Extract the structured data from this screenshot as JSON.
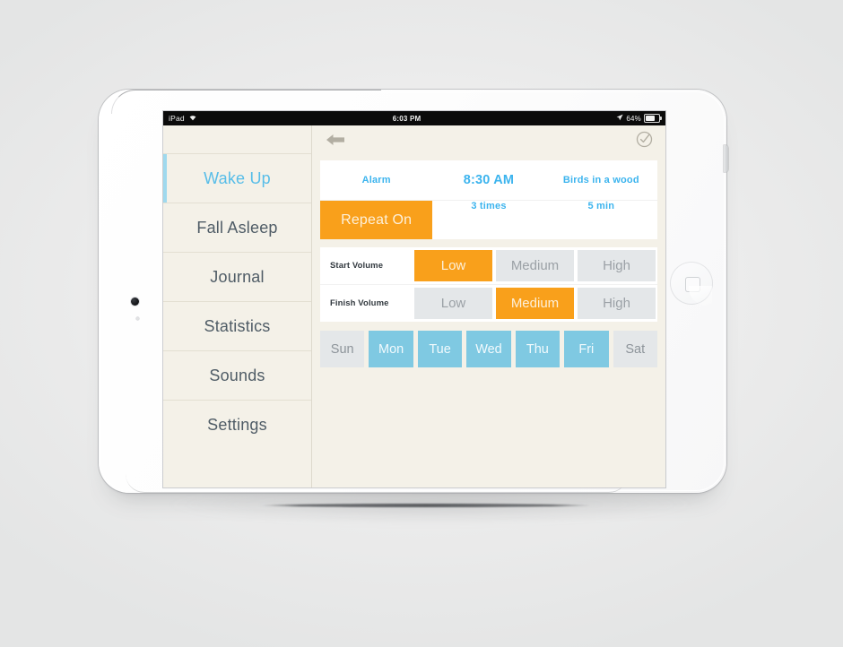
{
  "status_bar": {
    "carrier": "iPad",
    "wifi_icon": "wifi-icon",
    "time": "6:03 PM",
    "location_icon": "location-arrow-icon",
    "battery_percent": "64%",
    "battery_icon": "battery-icon"
  },
  "sidebar": {
    "items": [
      {
        "label": "Wake Up",
        "active": true
      },
      {
        "label": "Fall Asleep",
        "active": false
      },
      {
        "label": "Journal",
        "active": false
      },
      {
        "label": "Statistics",
        "active": false
      },
      {
        "label": "Sounds",
        "active": false
      },
      {
        "label": "Settings",
        "active": false
      }
    ]
  },
  "toolbar": {
    "back_icon": "back-arrow-icon",
    "confirm_icon": "check-circle-icon"
  },
  "alarm": {
    "label": "Alarm",
    "time": "8:30 AM",
    "sound": "Birds in a wood",
    "repeat_label": "Repeat On",
    "repeat_times": "3 times",
    "repeat_interval": "5 min"
  },
  "volume": {
    "start_label": "Start Volume",
    "finish_label": "Finish Volume",
    "options": [
      "Low",
      "Medium",
      "High"
    ],
    "start_selected": "Low",
    "finish_selected": "Medium"
  },
  "days": [
    {
      "label": "Sun",
      "on": false
    },
    {
      "label": "Mon",
      "on": true
    },
    {
      "label": "Tue",
      "on": true
    },
    {
      "label": "Wed",
      "on": true
    },
    {
      "label": "Thu",
      "on": true
    },
    {
      "label": "Fri",
      "on": true
    },
    {
      "label": "Sat",
      "on": false
    }
  ],
  "colors": {
    "accent_orange": "#f9a01b",
    "accent_blue": "#3cb4ee",
    "day_blue": "#7fc9e2",
    "cream": "#f4f1e8",
    "inactive_gray": "#e4e7e9"
  }
}
